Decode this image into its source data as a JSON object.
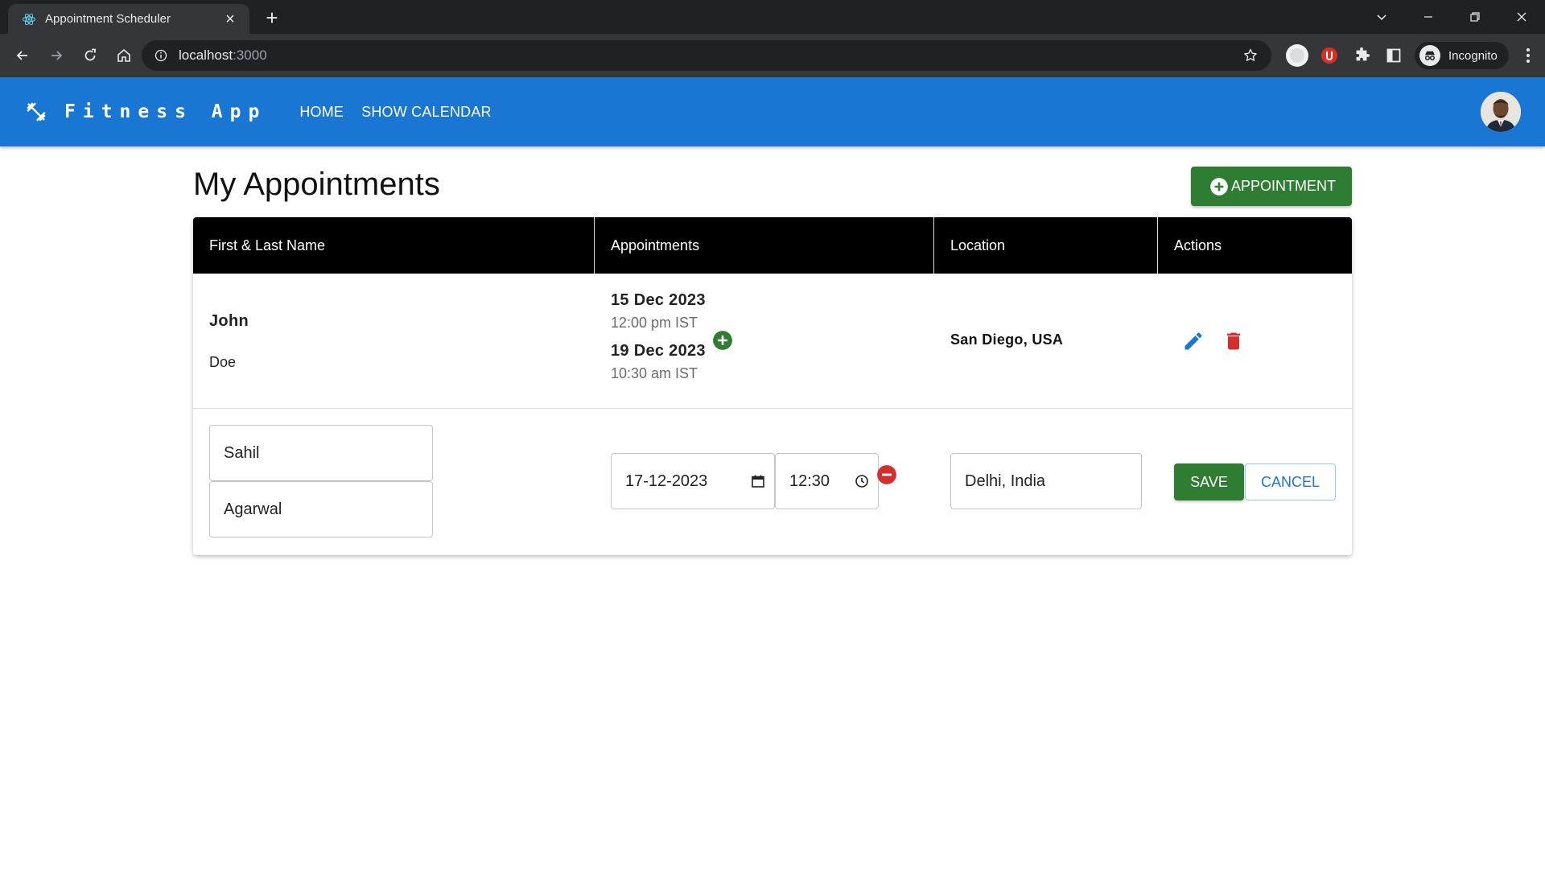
{
  "browser": {
    "tab_title": "Appointment Scheduler",
    "url_host": "localhost",
    "url_port": ":3000",
    "profile_label": "Incognito"
  },
  "app": {
    "brand": "Fitness App",
    "nav": [
      {
        "label": "HOME"
      },
      {
        "label": "SHOW CALENDAR"
      }
    ]
  },
  "page": {
    "title": "My Appointments",
    "add_button_label": "APPOINTMENT"
  },
  "table": {
    "columns": [
      "First & Last Name",
      "Appointments",
      "Location",
      "Actions"
    ],
    "rows": [
      {
        "first_name": "John",
        "last_name": "Doe",
        "appointments": [
          {
            "date": "15 Dec 2023",
            "time": "12:00 pm IST"
          },
          {
            "date": "19 Dec 2023",
            "time": "10:30 am IST"
          }
        ],
        "location": "San Diego, USA"
      }
    ],
    "edit_row": {
      "first_name": "Sahil",
      "last_name": "Agarwal",
      "date": "17-12-2023",
      "time": "12:30",
      "location": "Delhi, India",
      "save_label": "SAVE",
      "cancel_label": "CANCEL"
    }
  },
  "colors": {
    "appbar": "#1976d2",
    "success": "#2e7d32",
    "danger": "#d32f2f",
    "primary": "#1976d2",
    "table_header": "#000000"
  },
  "icons": {
    "brand": "dumbbell-icon",
    "add": "plus-circle-icon",
    "edit": "pencil-icon",
    "delete": "trash-icon",
    "remove": "minus-circle-icon",
    "calendar": "calendar-icon",
    "clock": "clock-icon"
  }
}
